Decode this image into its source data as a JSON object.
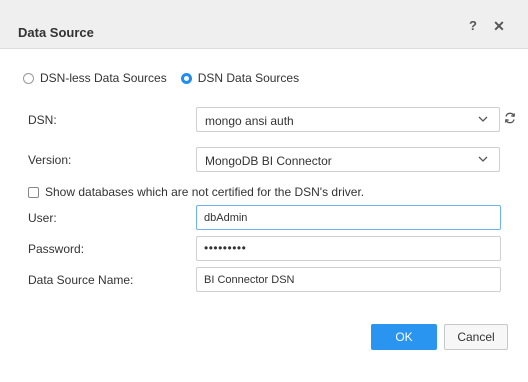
{
  "dialog": {
    "title": "Data Source",
    "help_symbol": "?",
    "close_symbol": "✕"
  },
  "connection_type": {
    "options": [
      {
        "label": "DSN-less Data Sources",
        "selected": false
      },
      {
        "label": "DSN Data Sources",
        "selected": true
      }
    ]
  },
  "form": {
    "dsn_label": "DSN:",
    "dsn_value": "mongo ansi auth",
    "version_label": "Version:",
    "version_value": "MongoDB BI Connector",
    "show_uncertified_label": "Show databases which are not certified for the DSN's driver.",
    "show_uncertified_checked": false,
    "user_label": "User:",
    "user_value": "dbAdmin",
    "password_label": "Password:",
    "password_mask": "•••••••••",
    "data_source_name_label": "Data Source Name:",
    "data_source_name_value": "BI Connector DSN"
  },
  "buttons": {
    "ok": "OK",
    "cancel": "Cancel"
  },
  "colors": {
    "accent": "#2a95f0",
    "focus_border": "#6fb0ef"
  },
  "icons": {
    "help": "help-icon",
    "close": "close-icon",
    "refresh": "refresh-icon",
    "dropdown": "chevron-down-icon"
  }
}
